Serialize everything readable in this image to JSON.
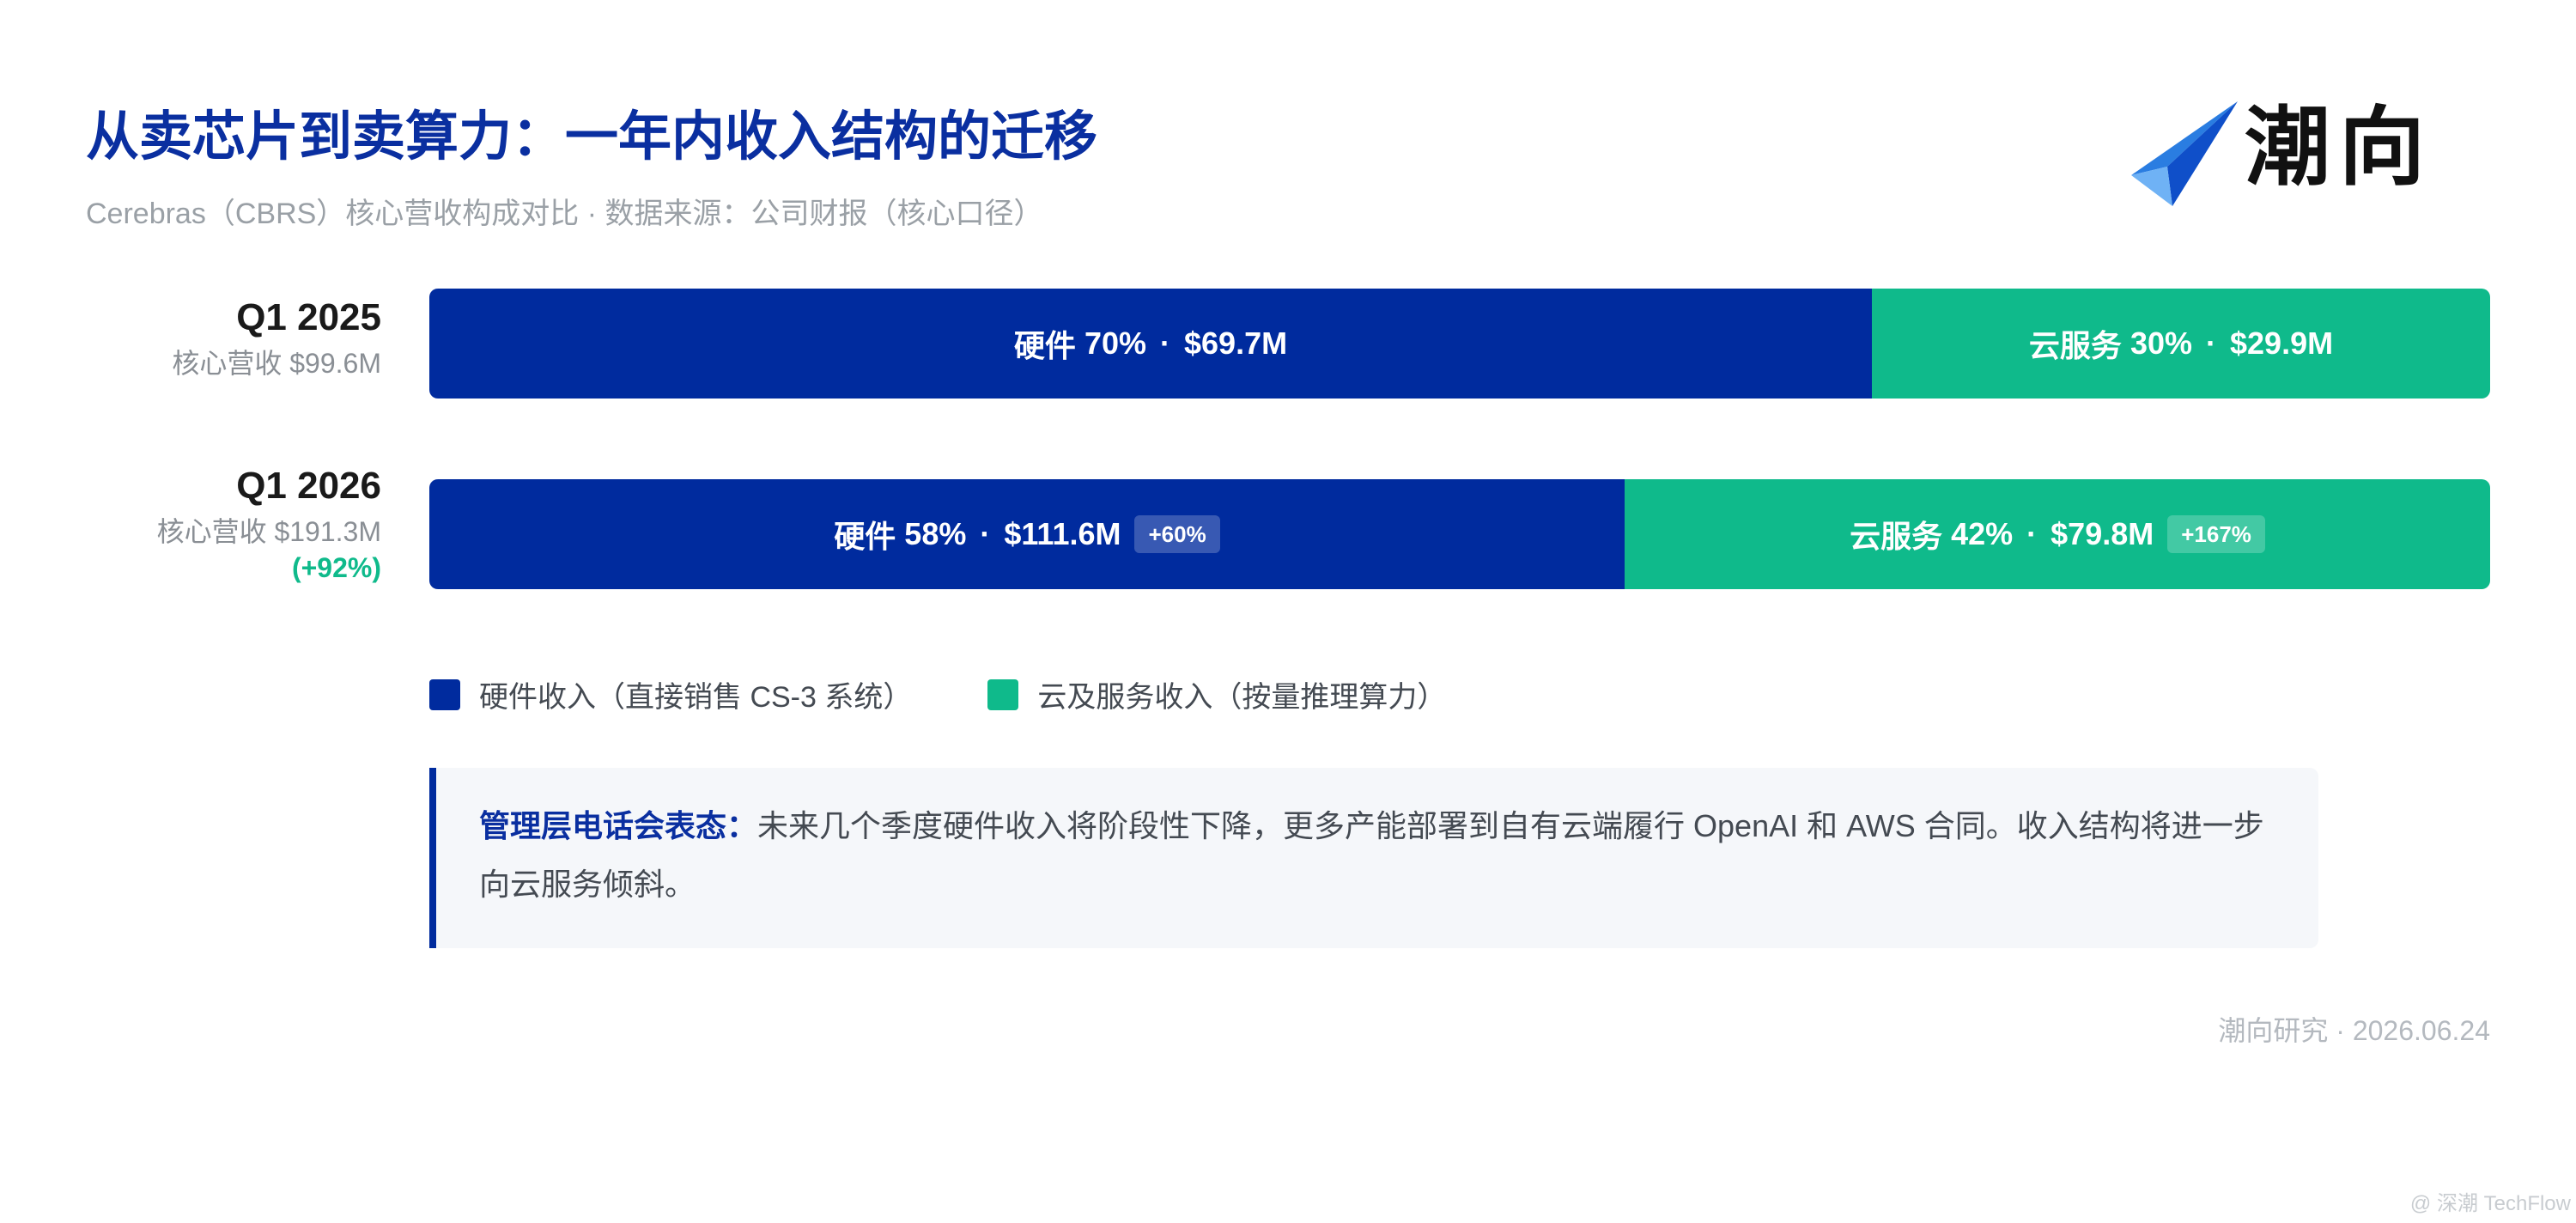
{
  "header": {
    "title": "从卖芯片到卖算力：一年内收入结构的迁移",
    "subtitle": "Cerebras（CBRS）核心营收构成对比 · 数据来源：公司财报（核心口径）"
  },
  "logo": {
    "text": "潮向"
  },
  "colors": {
    "title": "#0a2fa0",
    "hardware": "#002b9e",
    "cloud": "#0fba8b",
    "growth": "#0fba8b"
  },
  "chart_data": {
    "type": "bar",
    "stacked": "percent",
    "orientation": "horizontal",
    "rows": [
      {
        "period": "Q1 2025",
        "total_label": "核心营收 $99.6M",
        "growth_label": "",
        "segments": [
          {
            "key": "hardware",
            "name": "硬件",
            "percent": 70,
            "share_label": "70%",
            "value": 69.7,
            "value_label": "$69.7M",
            "badge": ""
          },
          {
            "key": "cloud",
            "name": "云服务",
            "percent": 30,
            "share_label": "30%",
            "value": 29.9,
            "value_label": "$29.9M",
            "badge": ""
          }
        ]
      },
      {
        "period": "Q1 2026",
        "total_label": "核心营收 $191.3M",
        "growth_label": "(+92%)",
        "segments": [
          {
            "key": "hardware",
            "name": "硬件",
            "percent": 58,
            "share_label": "58%",
            "value": 111.6,
            "value_label": "$111.6M",
            "badge": "+60%"
          },
          {
            "key": "cloud",
            "name": "云服务",
            "percent": 42,
            "share_label": "42%",
            "value": 79.8,
            "value_label": "$79.8M",
            "badge": "+167%"
          }
        ]
      }
    ],
    "legend": [
      {
        "key": "hardware",
        "label": "硬件收入（直接销售 CS-3 系统）"
      },
      {
        "key": "cloud",
        "label": "云及服务收入（按量推理算力）"
      }
    ],
    "legend_placement": "bottom-left"
  },
  "note": {
    "label": "管理层电话会表态：",
    "text": "未来几个季度硬件收入将阶段性下降，更多产能部署到自有云端履行 OpenAI 和 AWS 合同。收入结构将进一步向云服务倾斜。"
  },
  "footer": {
    "text": "潮向研究 · 2026.06.24"
  },
  "watermark": {
    "text": "@ 深潮 TechFlow"
  }
}
